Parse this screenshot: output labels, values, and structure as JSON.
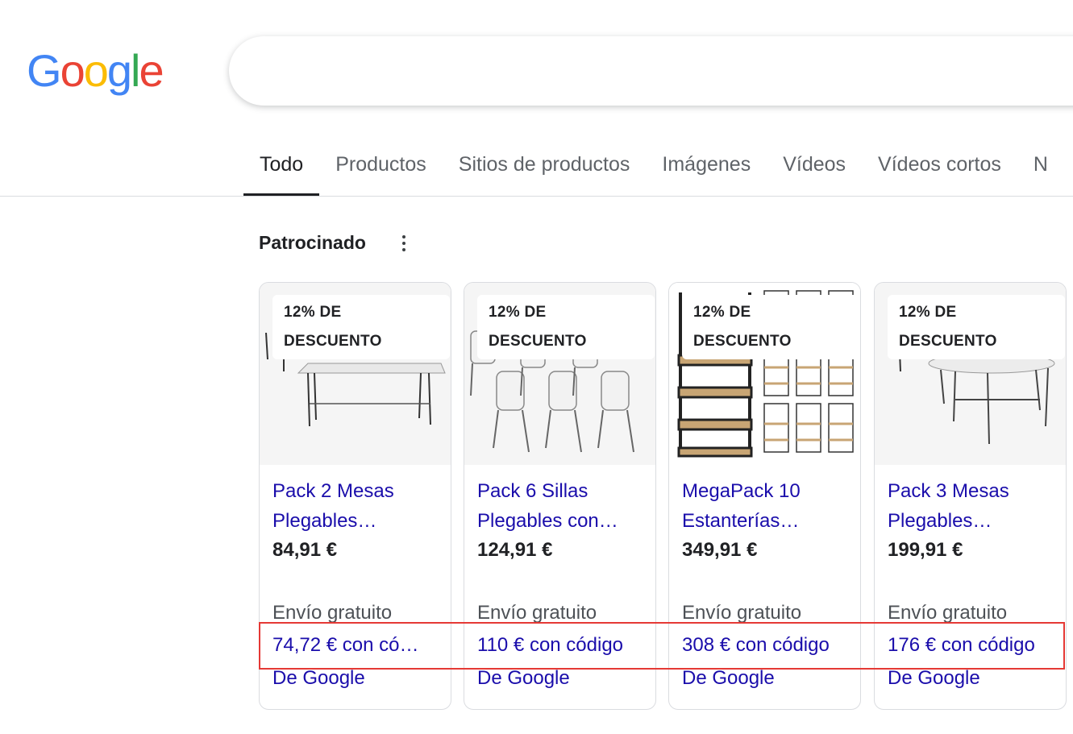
{
  "logo": {
    "letters": [
      "G",
      "o",
      "o",
      "g",
      "l",
      "e"
    ],
    "colors": [
      "#4285F4",
      "#EA4335",
      "#FBBC05",
      "#4285F4",
      "#34A853",
      "#EA4335"
    ]
  },
  "tabs": [
    {
      "label": "Todo",
      "active": true
    },
    {
      "label": "Productos"
    },
    {
      "label": "Sitios de productos"
    },
    {
      "label": "Imágenes"
    },
    {
      "label": "Vídeos"
    },
    {
      "label": "Vídeos cortos"
    },
    {
      "label": "N"
    }
  ],
  "sponsored": {
    "label": "Patrocinado",
    "icon": "more-vert-icon"
  },
  "products": [
    {
      "badge_line1": "12% DE",
      "badge_line2": "DESCUENTO",
      "image": "folding-table-icon",
      "title_line1": "Pack 2 Mesas",
      "title_line2": "Plegables…",
      "price": "84,91 €",
      "shipping": "Envío gratuito",
      "promo": "74,72 € con có…",
      "source": "De Google"
    },
    {
      "badge_line1": "12% DE",
      "badge_line2": "DESCUENTO",
      "image": "folding-chairs-icon",
      "title_line1": "Pack 6 Sillas",
      "title_line2": "Plegables con…",
      "price": "124,91 €",
      "shipping": "Envío gratuito",
      "promo": "110 € con código",
      "source": "De Google"
    },
    {
      "badge_line1": "12% DE",
      "badge_line2": "DESCUENTO",
      "image": "shelving-units-icon",
      "title_line1": "MegaPack 10",
      "title_line2": "Estanterías…",
      "price": "349,91 €",
      "shipping": "Envío gratuito",
      "promo": "308 € con código",
      "source": "De Google"
    },
    {
      "badge_line1": "12% DE",
      "badge_line2": "DESCUENTO",
      "image": "round-table-icon",
      "title_line1": "Pack 3 Mesas",
      "title_line2": "Plegables…",
      "price": "199,91 €",
      "shipping": "Envío gratuito",
      "promo": "176 € con código",
      "source": "De Google"
    }
  ],
  "highlight_color": "#e53935"
}
